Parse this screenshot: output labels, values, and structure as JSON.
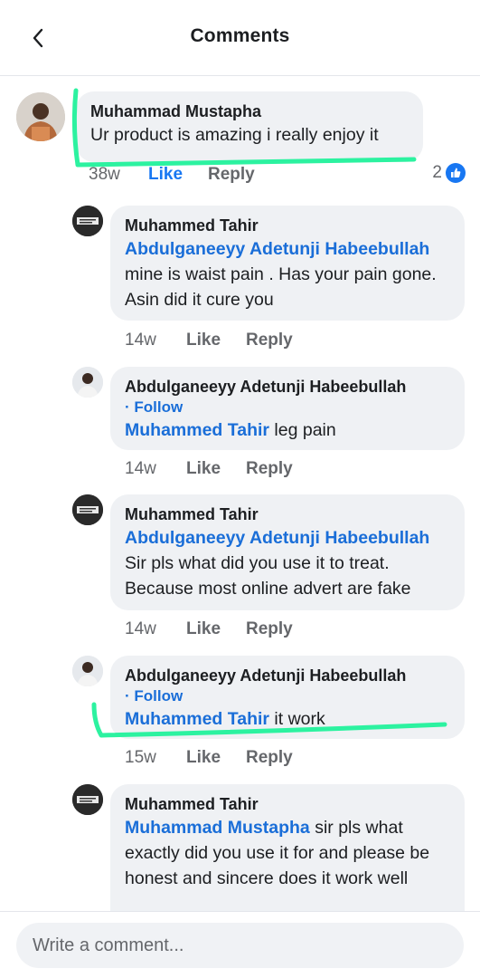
{
  "header": {
    "title": "Comments",
    "back_icon": "chevron-left-icon"
  },
  "comments": [
    {
      "name": "Muhammad Mustapha",
      "text": "Ur product is amazing i really enjoy it",
      "time": "38w",
      "like": "Like",
      "reply": "Reply",
      "reaction_count": "2",
      "reaction_icon": "thumbs-up-icon"
    },
    {
      "name": "Muhammed Tahir",
      "mention": "Abdulganeeyy Adetunji Habeebullah",
      "text": "mine is waist pain . Has your pain gone. Asin did it cure you",
      "time": "14w",
      "like": "Like",
      "reply": "Reply"
    },
    {
      "name": "Abdulganeeyy Adetunji Habeebullah",
      "follow": "· Follow",
      "mention": "Muhammed Tahir",
      "text": "leg pain",
      "time": "14w",
      "like": "Like",
      "reply": "Reply"
    },
    {
      "name": "Muhammed Tahir",
      "mention": "Abdulganeeyy Adetunji Habeebullah",
      "text": "Sir pls what did you use it to treat. Because most online advert are fake",
      "time": "14w",
      "like": "Like",
      "reply": "Reply"
    },
    {
      "name": "Abdulganeeyy Adetunji Habeebullah",
      "follow": "· Follow",
      "mention": "Muhammed Tahir",
      "text": "it work",
      "time": "15w",
      "like": "Like",
      "reply": "Reply"
    },
    {
      "name": "Muhammed Tahir",
      "mention": "Muhammad Mustapha",
      "text": "sir pls what exactly did you use it for and please be honest and sincere does it work well"
    }
  ],
  "composer": {
    "placeholder": "Write a comment..."
  },
  "colors": {
    "link": "#1a6ed8",
    "highlight": "#2cf2a0",
    "bubble": "#eff1f4"
  }
}
